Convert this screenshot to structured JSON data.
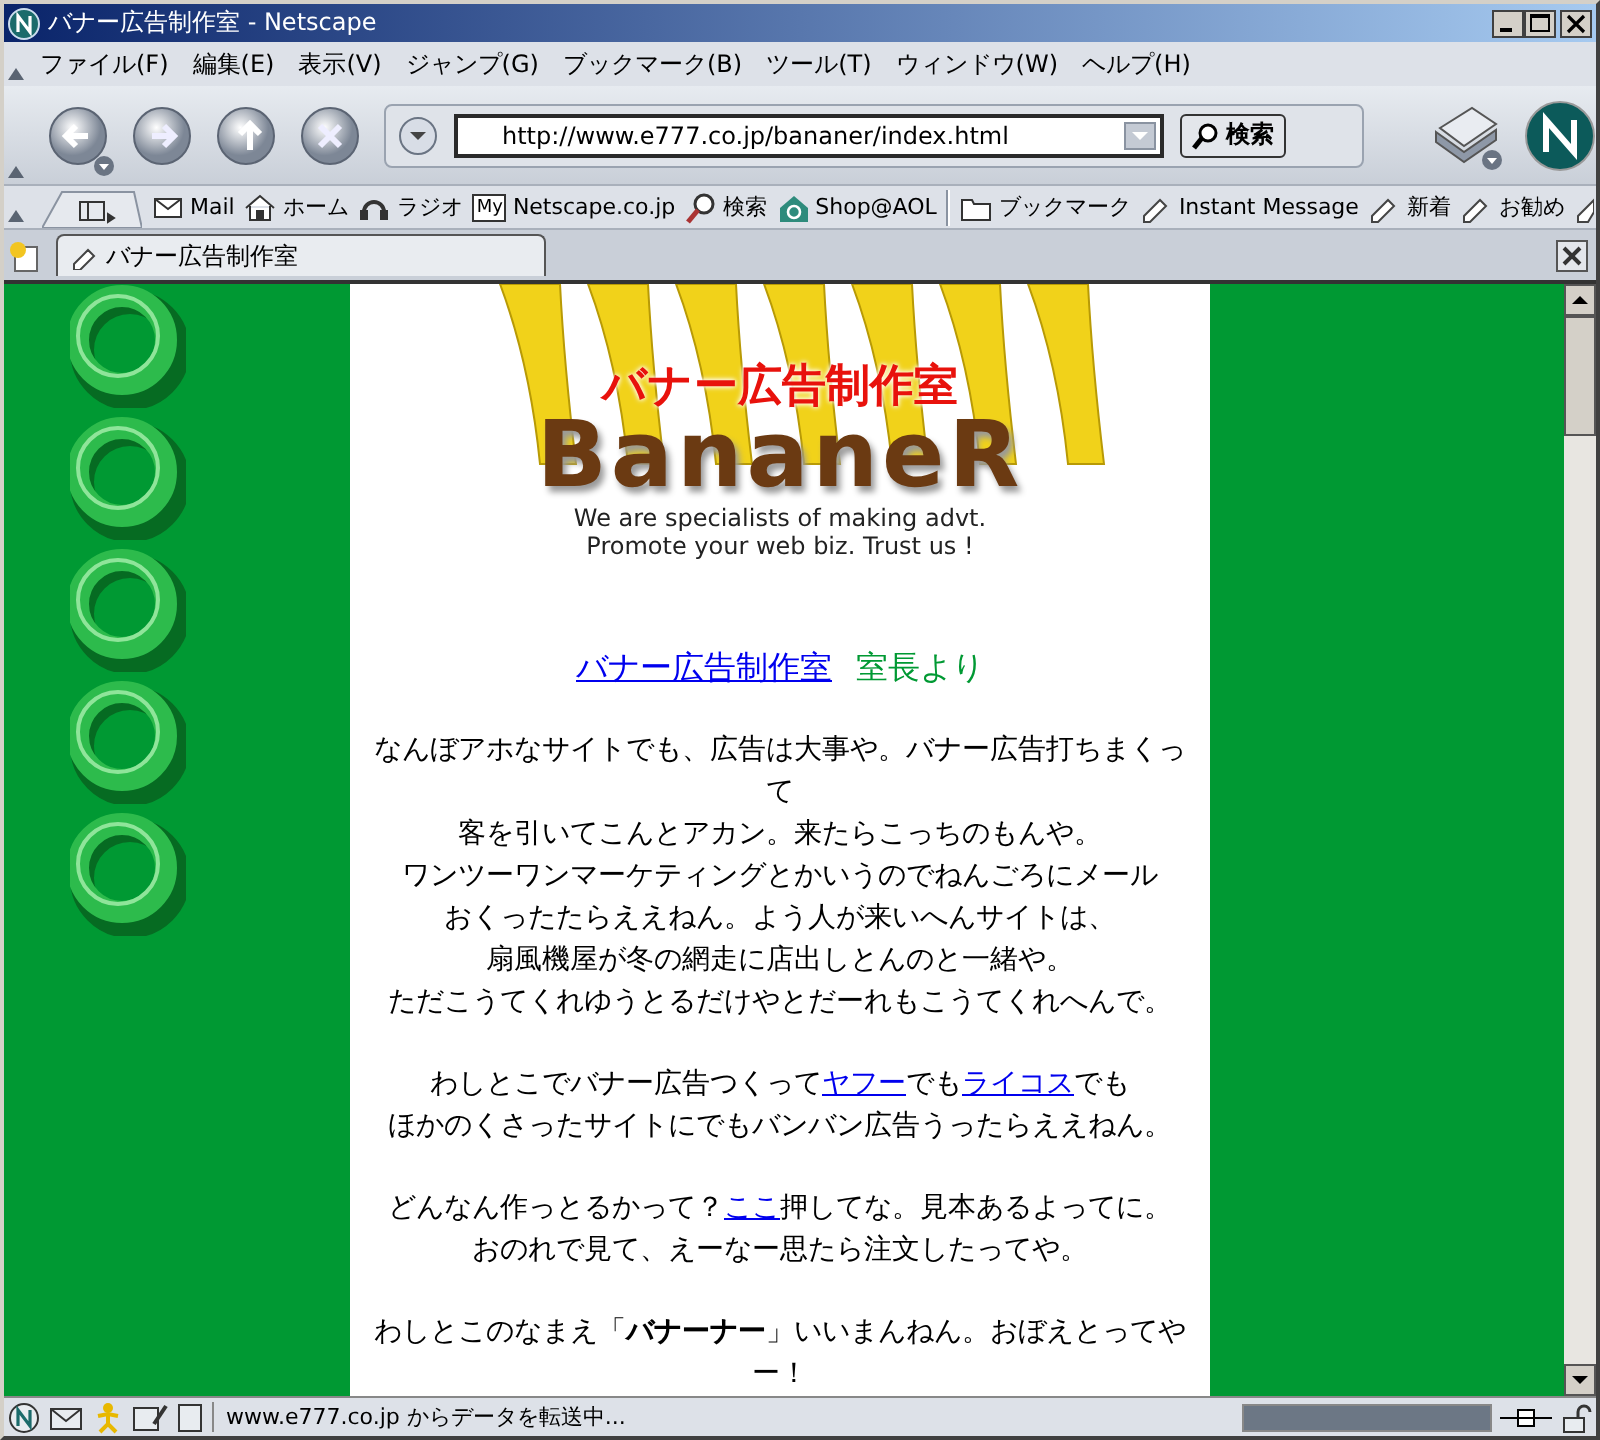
{
  "window": {
    "title": "バナー広告制作室 - Netscape"
  },
  "menu": [
    "ファイル(F)",
    "編集(E)",
    "表示(V)",
    "ジャンプ(G)",
    "ブックマーク(B)",
    "ツール(T)",
    "ウィンドウ(W)",
    "ヘルプ(H)"
  ],
  "navigation": {
    "url": "http://www.e777.co.jp/bananer/index.html",
    "search_button": "検索"
  },
  "personal_toolbar": [
    {
      "label": "Mail"
    },
    {
      "label": "ホーム"
    },
    {
      "label": "ラジオ"
    },
    {
      "label": "Netscape.co.jp",
      "badge": "My"
    },
    {
      "label": "検索"
    },
    {
      "label": "Shop@AOL"
    },
    {
      "label": "ブックマーク"
    },
    {
      "label": "Instant Message"
    },
    {
      "label": "新着"
    },
    {
      "label": "お勧め"
    }
  ],
  "tabs": [
    {
      "label": "バナー広告制作室",
      "selected": true
    }
  ],
  "page": {
    "logo": {
      "title": "バナー広告制作室",
      "wordmark": "BananeR",
      "tagline": [
        "We are specialists of making advt.",
        "Promote your web biz. Trust us !"
      ]
    },
    "heading": {
      "link": "バナー広告制作室",
      "note": "室長より"
    },
    "paragraphs": [
      [
        [
          {
            "kind": "text",
            "text": "なんぼアホなサイトでも、広告は大事や。バナー広告打ちまくって"
          }
        ],
        [
          {
            "kind": "text",
            "text": "客を引いてこんとアカン。来たらこっちのもんや。"
          }
        ],
        [
          {
            "kind": "text",
            "text": "ワンツーワンマーケティングとかいうのでねんごろにメール"
          }
        ],
        [
          {
            "kind": "text",
            "text": "おくったたらええねん。よう人が来いへんサイトは、"
          }
        ],
        [
          {
            "kind": "text",
            "text": "扇風機屋が冬の網走に店出しとんのと一緒や。"
          }
        ],
        [
          {
            "kind": "text",
            "text": "ただこうてくれゆうとるだけやとだーれもこうてくれへんで。"
          }
        ]
      ],
      [
        [
          {
            "kind": "text",
            "text": "わしとこでバナー広告つくって"
          },
          {
            "kind": "link",
            "text": "ヤフー"
          },
          {
            "kind": "text",
            "text": "でも"
          },
          {
            "kind": "link",
            "text": "ライコス"
          },
          {
            "kind": "text",
            "text": "でも"
          }
        ],
        [
          {
            "kind": "text",
            "text": "ほかのくさったサイトにでもバンバン広告うったらええねん。"
          }
        ]
      ],
      [
        [
          {
            "kind": "text",
            "text": "どんなん作っとるかって？"
          },
          {
            "kind": "link",
            "text": "ここ"
          },
          {
            "kind": "text",
            "text": "押してな。見本あるよってに。"
          }
        ],
        [
          {
            "kind": "text",
            "text": "おのれで見て、えーなー思たら注文したってや。"
          }
        ]
      ],
      [
        [
          {
            "kind": "text",
            "text": "わしとこのなまえ「**バナーナー**」いいまんねん。おぼえとってやー！"
          }
        ]
      ]
    ]
  },
  "status_bar": {
    "text": "www.e777.co.jp からデータを転送中...",
    "progress": {
      "level": 1
    }
  }
}
